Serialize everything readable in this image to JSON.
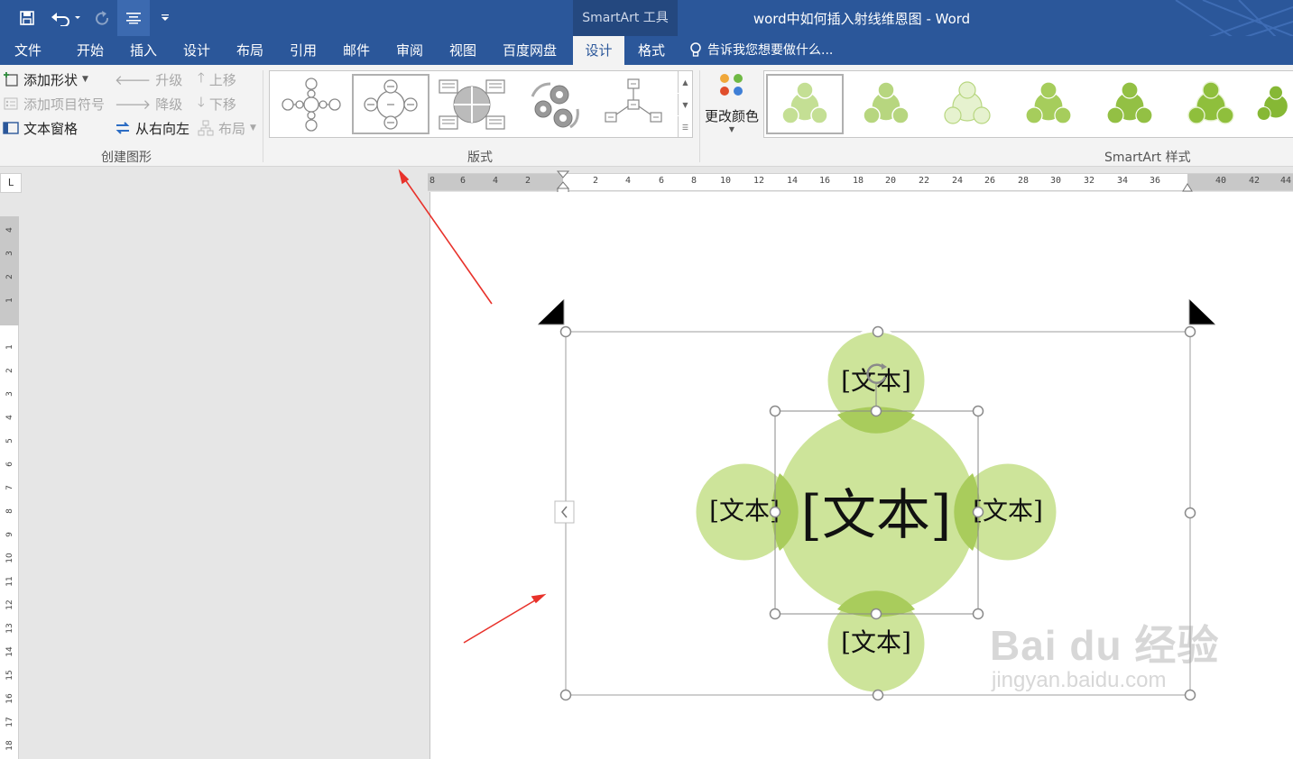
{
  "titlebar": {
    "context_tab": "SmartArt 工具",
    "doc_title": "word中如何插入射线维恩图 - Word"
  },
  "tabs": [
    {
      "label": "文件",
      "active": false
    },
    {
      "label": "开始",
      "active": false
    },
    {
      "label": "插入",
      "active": false
    },
    {
      "label": "设计",
      "active": false
    },
    {
      "label": "布局",
      "active": false
    },
    {
      "label": "引用",
      "active": false
    },
    {
      "label": "邮件",
      "active": false
    },
    {
      "label": "审阅",
      "active": false
    },
    {
      "label": "视图",
      "active": false
    },
    {
      "label": "百度网盘",
      "active": false
    },
    {
      "label": "设计",
      "active": true
    },
    {
      "label": "格式",
      "active": false
    }
  ],
  "tell_me": "告诉我您想要做什么...",
  "ribbon": {
    "create_graphic": {
      "add_shape": "添加形状",
      "add_bullet": "添加项目符号",
      "text_pane": "文本窗格",
      "promote": "升级",
      "demote": "降级",
      "right_to_left": "从右向左",
      "move_up": "上移",
      "move_down": "下移",
      "layout": "布局",
      "label": "创建图形"
    },
    "layouts": {
      "label": "版式"
    },
    "change_colors": "更改颜色",
    "smartart_styles": {
      "label": "SmartArt 样式"
    }
  },
  "ruler": {
    "corner": "L",
    "horizontal": [
      "8",
      "6",
      "4",
      "2",
      "",
      "2",
      "4",
      "6",
      "8",
      "10",
      "12",
      "14",
      "16",
      "18",
      "20",
      "22",
      "24",
      "26",
      "28",
      "30",
      "32",
      "34",
      "36",
      "",
      "40",
      "42",
      "44"
    ],
    "vertical": [
      "4",
      "3",
      "2",
      "1",
      "",
      "1",
      "2",
      "3",
      "4",
      "5",
      "6",
      "7",
      "8",
      "9",
      "10",
      "11",
      "12",
      "13",
      "14",
      "15",
      "16",
      "17",
      "18"
    ]
  },
  "diagram": {
    "center_text": "[文本]",
    "satellite_text": "[文本]",
    "colors": {
      "fill": "#cde49a",
      "fill_dark": "#a9cc5c",
      "outline": "#ffffff"
    }
  },
  "watermark": {
    "line1": "Bai  du 经验",
    "line2": "jingyan.baidu.com"
  }
}
